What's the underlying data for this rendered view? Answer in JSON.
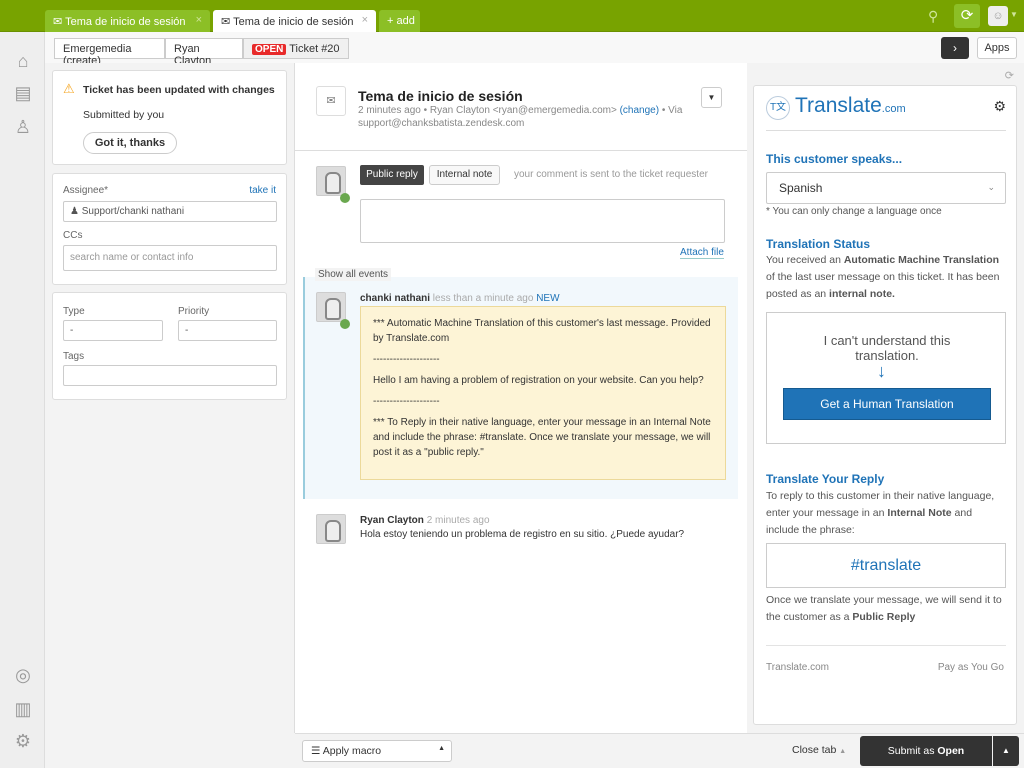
{
  "tabs": [
    {
      "label": "Tema de inicio de sesión",
      "active": false
    },
    {
      "label": "Tema de inicio de sesión",
      "active": true
    }
  ],
  "add_label": "+ add",
  "breadcrumb": {
    "org": "Emergemedia (create)",
    "user": "Ryan Clayton",
    "status": "OPEN",
    "ticket": "Ticket #20"
  },
  "apps_label": "Apps",
  "notice": {
    "title": "Ticket has been updated with changes",
    "sub": "Submitted by you",
    "button": "Got it, thanks"
  },
  "props": {
    "assignee_label": "Assignee*",
    "take_it": "take it",
    "assignee": "Support/chanki nathani",
    "ccs_label": "CCs",
    "ccs_placeholder": "search name or contact info",
    "type_label": "Type",
    "type_value": "-",
    "priority_label": "Priority",
    "priority_value": "-",
    "tags_label": "Tags"
  },
  "ticket": {
    "title": "Tema de inicio de sesión",
    "time": "2 minutes ago",
    "requester": "Ryan Clayton <ryan@emergemedia.com>",
    "change": "(change)",
    "via": "Via",
    "via_addr": "support@chanksbatista.zendesk.com"
  },
  "composer": {
    "public": "Public reply",
    "internal": "Internal note",
    "hint": "your comment is sent to the ticket requester",
    "attach": "Attach file"
  },
  "show_all": "Show all events",
  "events": [
    {
      "author": "chanki nathani",
      "time": "less than a minute ago",
      "badge": "NEW",
      "lines": [
        "*** Automatic Machine Translation of this customer's last message. Provided by Translate.com",
        "--------------------",
        "Hello I am having a problem of registration on your website. Can you help?",
        "--------------------",
        "*** To Reply in their native language, enter your message in an Internal Note and include the phrase: #translate. Once we translate your message, we will post it as a \"public reply.\""
      ]
    },
    {
      "author": "Ryan Clayton",
      "time": "2 minutes ago",
      "body": "Hola estoy teniendo un problema de registro en su sitio. ¿Puede ayudar?"
    }
  ],
  "app": {
    "logo": "Translate",
    "logo_suffix": ".com",
    "speaks_h": "This customer speaks...",
    "language": "Spanish",
    "note": "* You can only change a language once",
    "status_h": "Translation Status",
    "status_1": "You received an ",
    "status_b1": "Automatic Machine Translation",
    "status_2": " of the last user message on this ticket. It has been posted as an ",
    "status_b2": "internal note.",
    "cant": "I can't understand this translation.",
    "human_btn": "Get a Human Translation",
    "reply_h": "Translate Your Reply",
    "reply_1": "To reply to this customer in their native language, enter your message in an ",
    "reply_b": "Internal Note",
    "reply_2": " and include the phrase:",
    "phrase": "#translate",
    "once_1": "Once we translate your message, we will send it to the customer as a ",
    "once_b": "Public Reply",
    "footer_l": "Translate.com",
    "footer_r": "Pay as You Go"
  },
  "bottom": {
    "macro": "Apply macro",
    "close_tab": "Close tab",
    "submit": "Submit as ",
    "submit_b": "Open"
  },
  "colors": {
    "brand": "#78a300",
    "accent": "#1f73b7",
    "open": "#e82a2a"
  }
}
